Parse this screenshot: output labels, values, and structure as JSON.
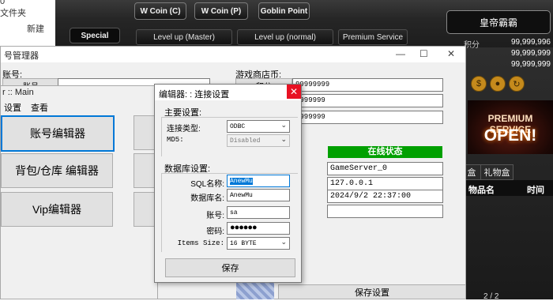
{
  "explorer": {
    "line1": "0",
    "line2": "文件夹",
    "new_label": "新建"
  },
  "game": {
    "top_buttons": [
      "W Coin (C)",
      "W Coin (P)",
      "Goblin Point"
    ],
    "special": "Special",
    "tabs": [
      "Level up (Master)",
      "Level up (normal)",
      "Premium Service"
    ],
    "emperor": "皇帝霸霸",
    "stats": [
      {
        "label": "积分",
        "value": "99,999,996"
      },
      {
        "label": "",
        "value": "99,999,999"
      },
      {
        "label": "",
        "value": "99,999,999"
      }
    ],
    "premium_line1": "PREMIUM SERVICE",
    "premium_line2": "OPEN!",
    "gift_tabs": [
      "盒",
      "礼物盒"
    ],
    "item_header": {
      "name": "物品名",
      "time": "时间"
    },
    "bottom_right": "2 / 2"
  },
  "manager": {
    "title": "号管理器",
    "account_label": "账号:",
    "account_btn": "账号",
    "shop_label": "游戏商店币:",
    "shop_btn": "积分",
    "shop_values": [
      "99999999",
      "9999999",
      "9999999"
    ],
    "online_title": "在线状态",
    "server": "GameServer_0",
    "ip": "127.0.0.1",
    "datetime": "2024/9/2 22:37:00",
    "save_settings": "保存设置"
  },
  "main_win": {
    "title": "r :: Main",
    "menu": [
      "设置",
      "查看"
    ],
    "buttons": [
      "账号编辑器",
      "背包/仓库 编辑器",
      "Vip编辑器"
    ]
  },
  "dialog": {
    "title": "编辑器: : 连接设置",
    "main_group": "主要设置:",
    "conn_type_label": "连接类型:",
    "conn_type_value": "ODBC",
    "md5_label": "MD5:",
    "md5_value": "Disabled",
    "db_group": "数据库设置:",
    "sql_label": "SQL名称:",
    "sql_value": "AnewMu",
    "dbname_label": "数据库名:",
    "dbname_value": "AnewMu",
    "account_label": "账号:",
    "account_value": "sa",
    "password_label": "密码:",
    "password_value": "●●●●●●",
    "items_size_label": "Items Size:",
    "items_size_value": "16 BYTE",
    "save": "保存"
  }
}
